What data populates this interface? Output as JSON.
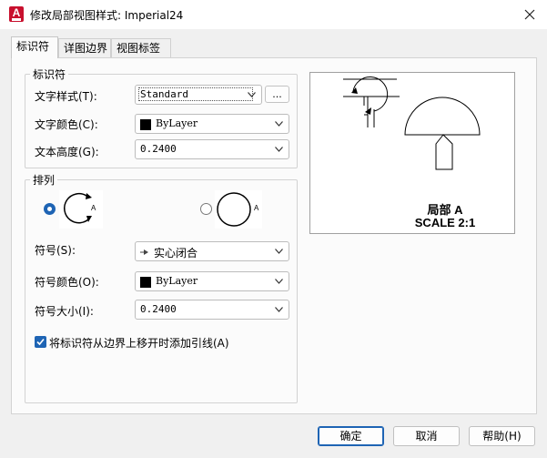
{
  "window": {
    "title": "修改局部视图样式: Imperial24",
    "app_icon_letter": "A"
  },
  "tabs": [
    {
      "label": "标识符",
      "active": true
    },
    {
      "label": "详图边界",
      "active": false
    },
    {
      "label": "视图标签",
      "active": false
    }
  ],
  "identifier_group": {
    "title": "标识符",
    "text_style_label": "文字样式(T):",
    "text_style_value": "Standard",
    "browse_label": "...",
    "text_color_label": "文字颜色(C):",
    "text_color_value": "ByLayer",
    "text_height_label": "文本高度(G):",
    "text_height_value": "0.2400"
  },
  "arrangement_group": {
    "title": "排列",
    "option1_letter": "A",
    "option2_letter": "A",
    "selected_option": 1,
    "symbol_label": "符号(S):",
    "symbol_value": "实心闭合",
    "symbol_color_label": "符号颜色(O):",
    "symbol_color_value": "ByLayer",
    "symbol_size_label": "符号大小(I):",
    "symbol_size_value": "0.2400",
    "leader_checkbox_label": "将标识符从边界上移开时添加引线(A)",
    "leader_checked": true
  },
  "preview": {
    "caption_line1": "局部 A",
    "caption_line2": "SCALE 2:1"
  },
  "footer": {
    "ok": "确定",
    "cancel": "取消",
    "help": "帮助(H)"
  },
  "colors": {
    "accent": "#1e64b4",
    "app_icon": "#c8102e"
  }
}
